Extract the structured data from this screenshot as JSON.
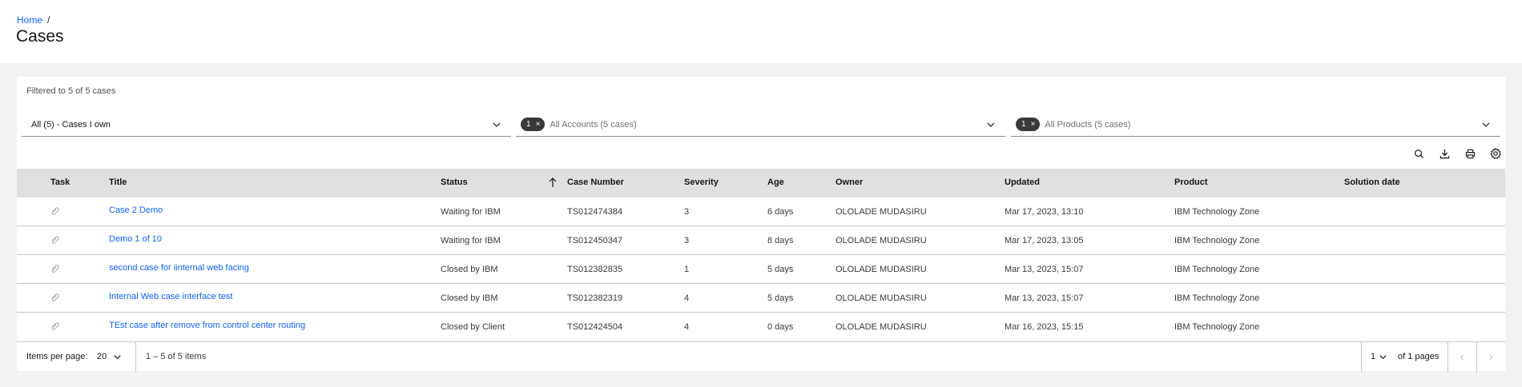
{
  "breadcrumb": {
    "home": "Home",
    "separator": "/"
  },
  "page_title": "Cases",
  "filter_summary": "Filtered to 5 of 5 cases",
  "filters": {
    "view": {
      "value": "All (5) - Cases I own"
    },
    "accounts": {
      "tag_count": "1",
      "tag_clear": "×",
      "placeholder": "All Accounts (5 cases)"
    },
    "products": {
      "tag_count": "1",
      "tag_clear": "×",
      "placeholder": "All Products (5 cases)"
    }
  },
  "toolbar_icons": [
    "search-icon",
    "download-icon",
    "print-icon",
    "settings-icon"
  ],
  "table": {
    "columns": {
      "task": "Task",
      "title": "Title",
      "status": "Status",
      "case_number": "Case Number",
      "severity": "Severity",
      "age": "Age",
      "owner": "Owner",
      "updated": "Updated",
      "product": "Product",
      "solution_date": "Solution date"
    },
    "sorted_by": "status",
    "rows": [
      {
        "title": "Case 2 Demo",
        "status": "Waiting for IBM",
        "case_number": "TS012474384",
        "severity": "3",
        "age": "6 days",
        "owner": "OLOLADE MUDASIRU",
        "updated": "Mar 17, 2023, 13:10",
        "product": "IBM Technology Zone",
        "solution_date": ""
      },
      {
        "title": "Demo 1 of 10",
        "status": "Waiting for IBM",
        "case_number": "TS012450347",
        "severity": "3",
        "age": "8 days",
        "owner": "OLOLADE MUDASIRU",
        "updated": "Mar 17, 2023, 13:05",
        "product": "IBM Technology Zone",
        "solution_date": ""
      },
      {
        "title": "second case for iinternal web facing",
        "status": "Closed by IBM",
        "case_number": "TS012382835",
        "severity": "1",
        "age": "5 days",
        "owner": "OLOLADE MUDASIRU",
        "updated": "Mar 13, 2023, 15:07",
        "product": "IBM Technology Zone",
        "solution_date": ""
      },
      {
        "title": "Internal Web case interface test",
        "status": "Closed by IBM",
        "case_number": "TS012382319",
        "severity": "4",
        "age": "5 days",
        "owner": "OLOLADE MUDASIRU",
        "updated": "Mar 13, 2023, 15:07",
        "product": "IBM Technology Zone",
        "solution_date": ""
      },
      {
        "title": "TEst case after remove from control center routing",
        "status": "Closed by Client",
        "case_number": "TS012424504",
        "severity": "4",
        "age": "0 days",
        "owner": "OLOLADE MUDASIRU",
        "updated": "Mar 16, 2023, 15:15",
        "product": "IBM Technology Zone",
        "solution_date": ""
      }
    ]
  },
  "pagination": {
    "items_per_page_label": "Items per page:",
    "items_per_page": "20",
    "range": "1 – 5 of 5 items",
    "current_page": "1",
    "of_pages": "of 1 pages"
  },
  "colors": {
    "accent": "#0f62fe",
    "header_bg": "#e0e0e0",
    "tag_bg": "#393939",
    "page_bg": "#f2f2f2"
  }
}
